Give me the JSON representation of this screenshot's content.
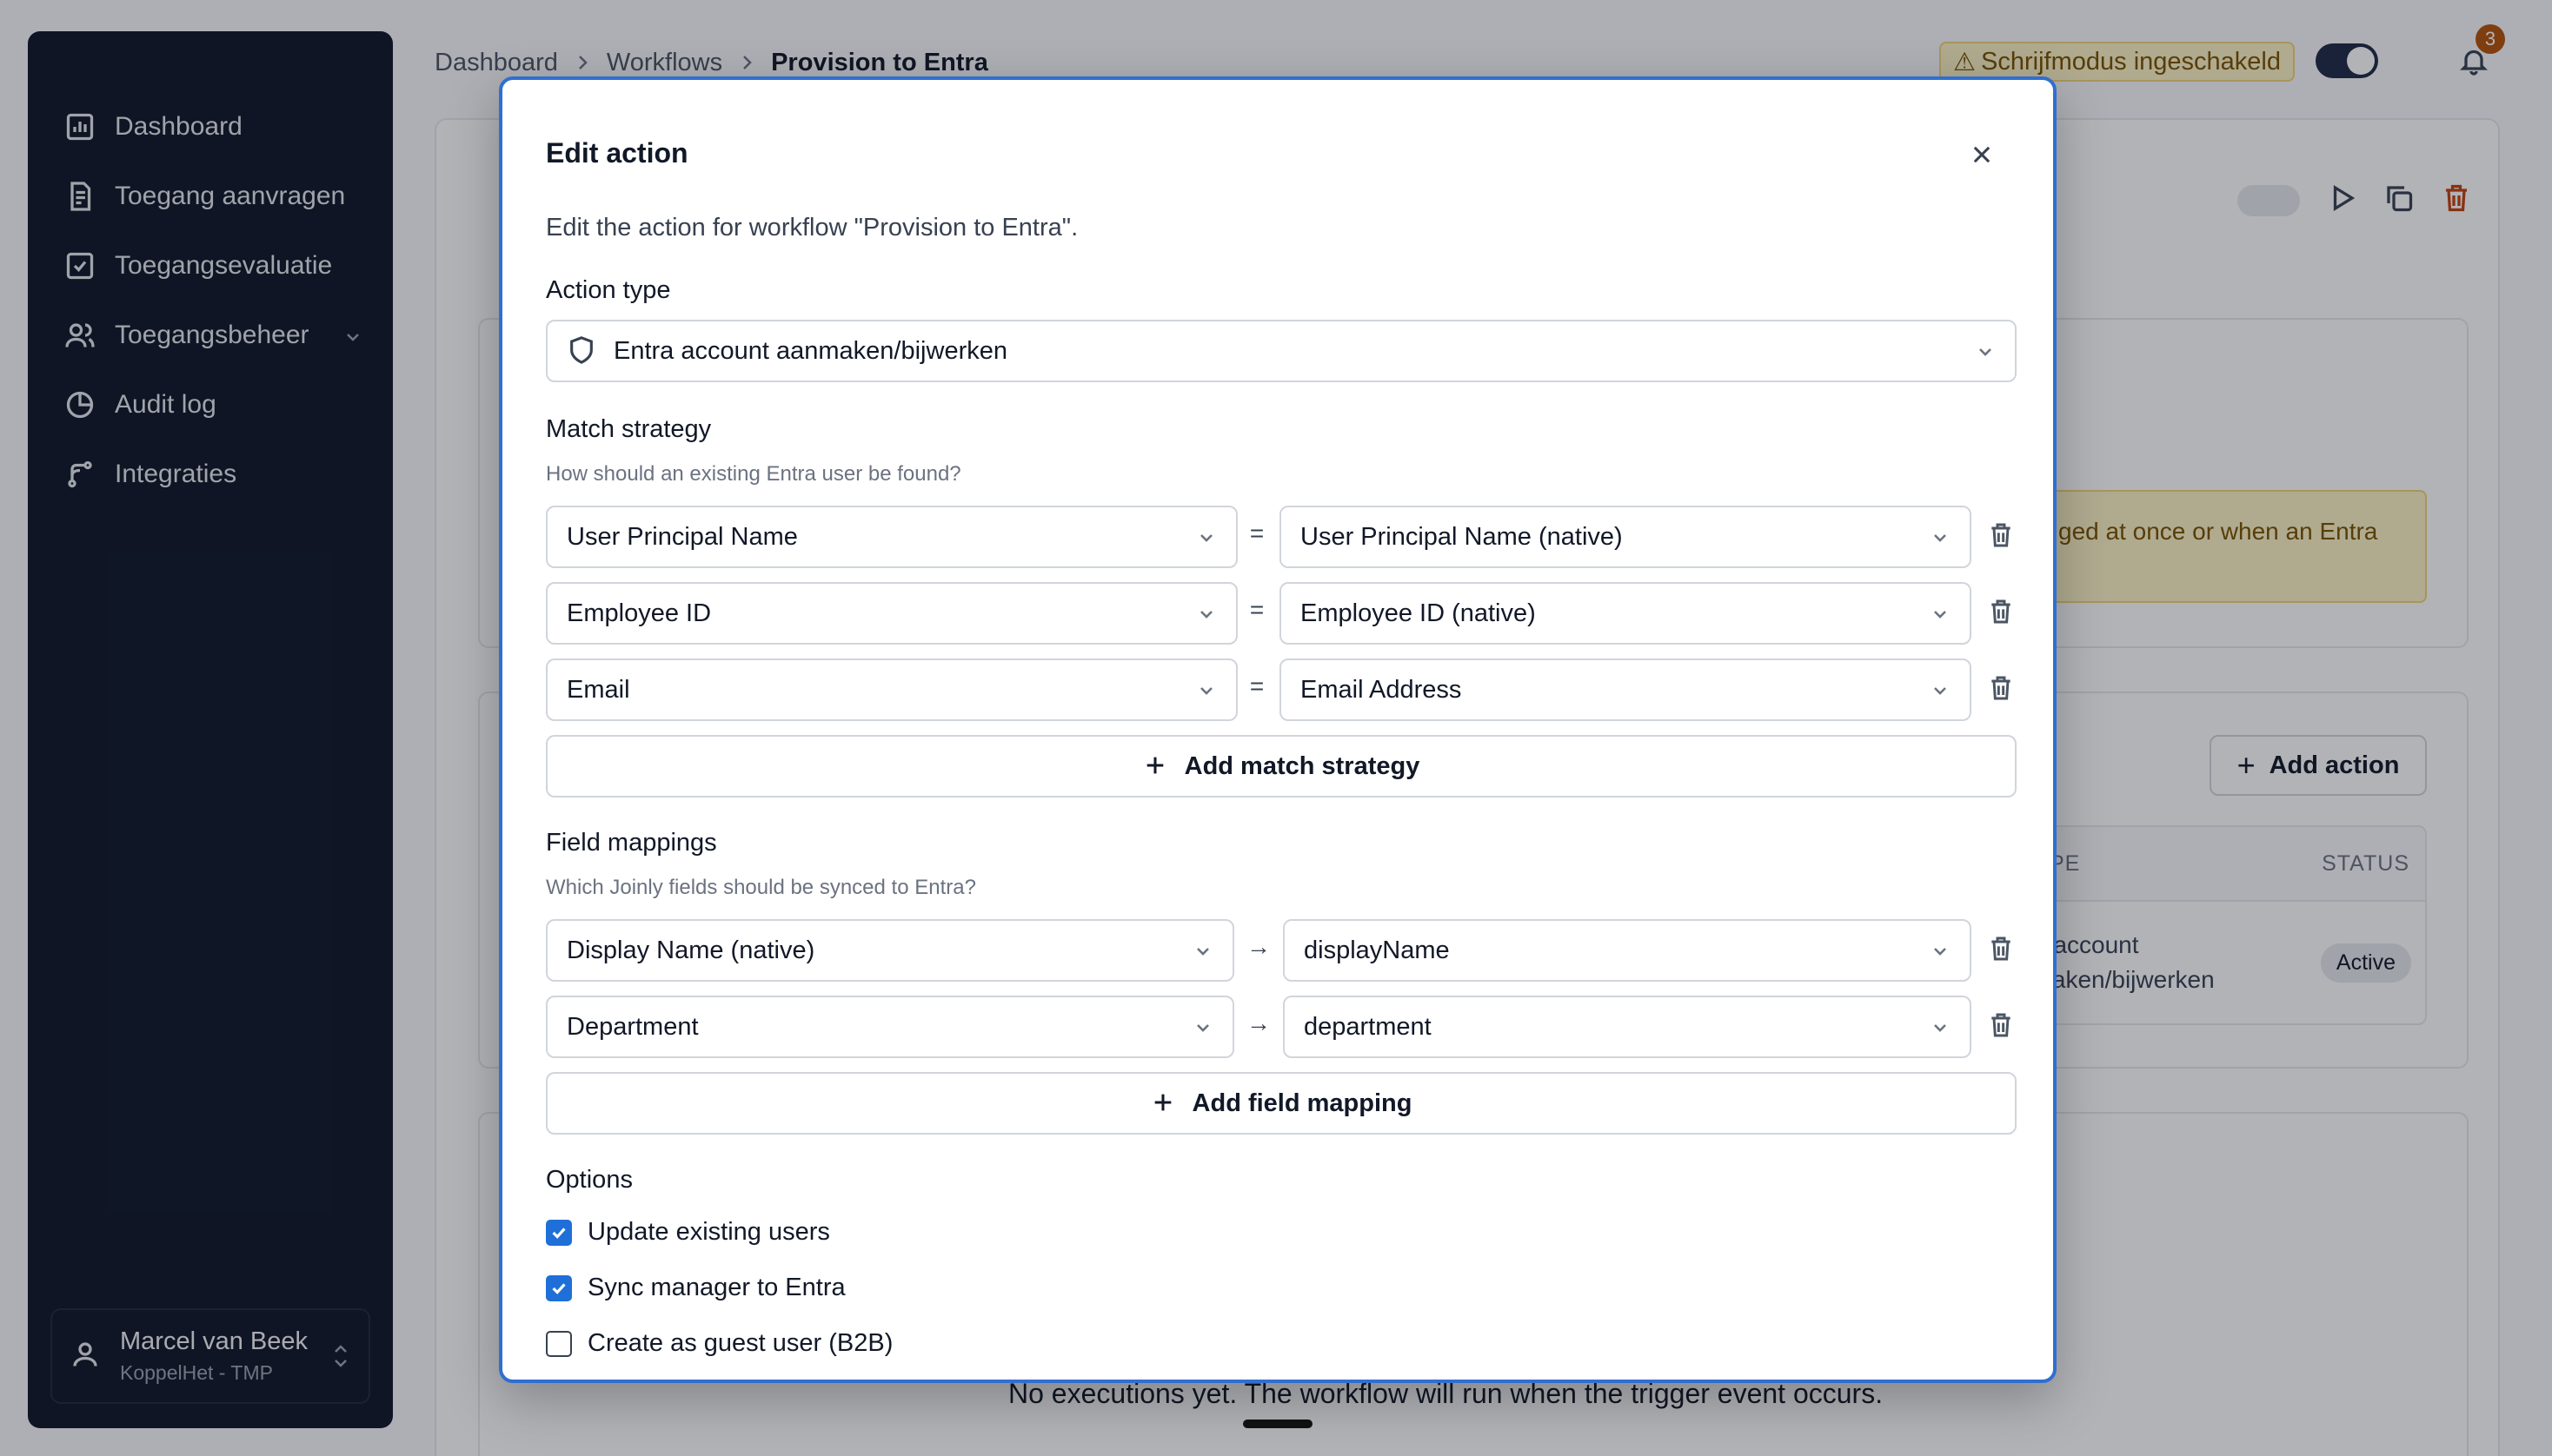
{
  "sidebar": {
    "items": [
      {
        "label": "Dashboard",
        "icon": "chart-icon"
      },
      {
        "label": "Toegang aanvragen",
        "icon": "request-icon"
      },
      {
        "label": "Toegangsevaluatie",
        "icon": "checkbox-icon"
      },
      {
        "label": "Toegangsbeheer",
        "icon": "users-icon"
      },
      {
        "label": "Audit log",
        "icon": "pie-icon"
      },
      {
        "label": "Integraties",
        "icon": "branch-icon"
      }
    ],
    "user": {
      "name": "Marcel van Beek",
      "org": "KoppelHet - TMP"
    }
  },
  "topbar": {
    "breadcrumb": [
      "Dashboard",
      "Workflows",
      "Provision to Entra"
    ],
    "write_mode": "Schrijfmodus ingeschakeld",
    "notification_count": "3"
  },
  "background": {
    "alert_text": "ged at once or when an Entra",
    "add_action": "Add action",
    "table_header_type": "PE",
    "table_header_status": "STATUS",
    "table_row_type": "tra account\nnmaken/bijwerken",
    "table_row_status": "Active",
    "empty_text": "No executions yet. The workflow will run when the trigger event occurs."
  },
  "modal": {
    "title": "Edit action",
    "description": "Edit the action for workflow \"Provision to Entra\".",
    "action_type_label": "Action type",
    "action_type_value": "Entra account aanmaken/bijwerken",
    "match_label": "Match strategy",
    "match_help": "How should an existing Entra user be found?",
    "match_rows": [
      {
        "left": "User Principal Name",
        "op": "=",
        "right": "User Principal Name (native)"
      },
      {
        "left": "Employee ID",
        "op": "=",
        "right": "Employee ID (native)"
      },
      {
        "left": "Email",
        "op": "=",
        "right": "Email Address"
      }
    ],
    "add_match": "Add match strategy",
    "mapping_label": "Field mappings",
    "mapping_help": "Which Joinly fields should be synced to Entra?",
    "mapping_rows": [
      {
        "left": "Display Name (native)",
        "op": "→",
        "right": "displayName"
      },
      {
        "left": "Department",
        "op": "→",
        "right": "department"
      }
    ],
    "add_mapping": "Add field mapping",
    "options_label": "Options",
    "options": [
      {
        "label": "Update existing users",
        "checked": true
      },
      {
        "label": "Sync manager to Entra",
        "checked": true
      },
      {
        "label": "Create as guest user (B2B)",
        "checked": false
      }
    ]
  },
  "colors": {
    "accent": "#1f6fd9",
    "sidebar": "#0f1729",
    "warning_bg": "#fdf3c4"
  }
}
